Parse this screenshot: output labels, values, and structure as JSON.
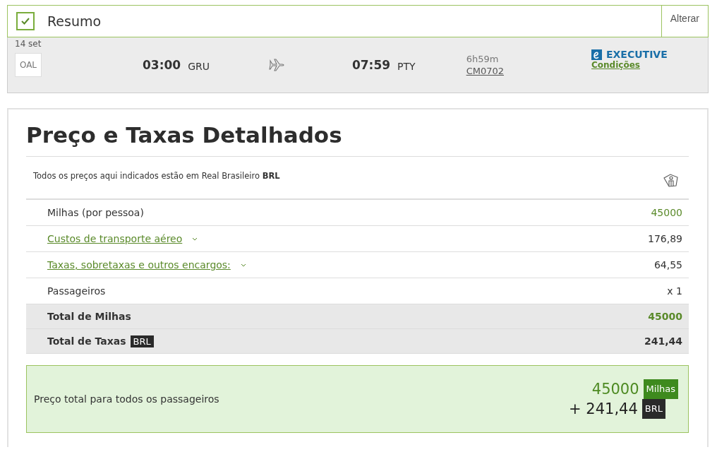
{
  "summary": {
    "checked": true,
    "title": "Resumo",
    "change_button": "Alterar"
  },
  "flight": {
    "date": "14 set",
    "airline": "OAL",
    "departure_time": "03:00",
    "departure_airport": "GRU",
    "arrival_time": "07:59",
    "arrival_airport": "PTY",
    "duration": "6h59m",
    "flight_number": "CM0702",
    "cabin": "EXECUTIVE",
    "conditions_link": "Condições"
  },
  "details": {
    "title": "Preço e Taxas Detalhados",
    "currency_note": "Todos os preços aqui indicados estão em Real Brasileiro **BRL**",
    "rows": [
      {
        "kind": "plain",
        "label": "Milhas (por pessoa)",
        "value": "45000",
        "highlight": true
      },
      {
        "kind": "expandable",
        "label": "Custos de transporte aéreo",
        "expanded": false,
        "value": "176,89",
        "highlight": false
      },
      {
        "kind": "expandable",
        "label": "Taxas, sobretaxas e outros encargos:",
        "expanded": false,
        "value": "64,55",
        "highlight": false
      },
      {
        "kind": "plain",
        "label": "Passageiros",
        "value": "x 1",
        "highlight": false
      },
      {
        "kind": "total",
        "label": "Total de Milhas",
        "value": "45000",
        "highlight": true
      },
      {
        "kind": "total",
        "label": "Total de Taxas",
        "badge": "BRL",
        "value": "241,44",
        "highlight": false
      }
    ]
  },
  "grand_total": {
    "label": "Preço total para todos os passageiros",
    "miles": "45000",
    "miles_badge": "Milhas",
    "money": "+ 241,44",
    "money_badge": "BRL"
  }
}
